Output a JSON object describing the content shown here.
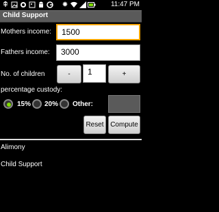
{
  "status_bar": {
    "time": "11:47 PM",
    "icons": [
      "usb-icon",
      "image-icon",
      "bug-icon",
      "image-icon",
      "android-icon",
      "g-icon",
      "sync-icon",
      "wifi-icon",
      "signal-icon",
      "battery-icon"
    ]
  },
  "app": {
    "title": "Child Support"
  },
  "form": {
    "mothers_income_label": "Mothers income:",
    "mothers_income_value": "1500",
    "fathers_income_label": "Fathers income:",
    "fathers_income_value": "3000",
    "children_label": "No. of children",
    "children_minus": "-",
    "children_value": "1",
    "children_plus": "+",
    "custody_label": "percentage custody:",
    "custody_options": [
      "15%",
      "20%",
      "Other:"
    ],
    "custody_selected": "15%",
    "other_value": ""
  },
  "actions": {
    "reset": "Reset",
    "compute": "Compute"
  },
  "results": {
    "alimony": "Alimony",
    "child_support": "Child Support"
  },
  "colors": {
    "title_bar": "#5a5a5a",
    "focus_border": "#f4a400",
    "radio_selected": "#7fdc00"
  }
}
